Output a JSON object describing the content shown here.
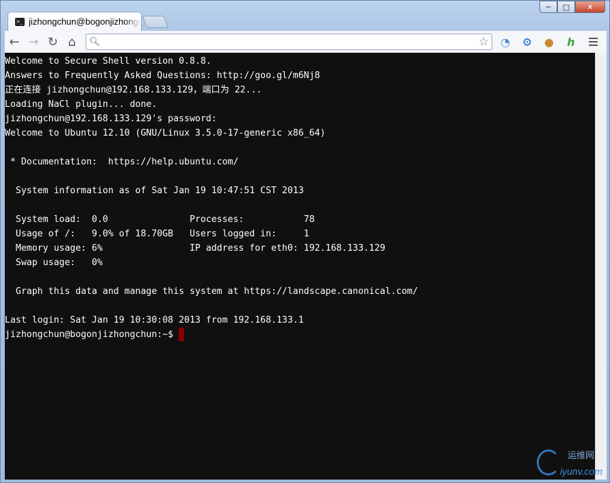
{
  "window": {
    "tab_title": "jizhongchun@bogonjizhongchun:~",
    "favicon_glyph": ">_",
    "controls": {
      "minimize": "─",
      "maximize": "□",
      "close": "✕"
    }
  },
  "toolbar": {
    "back": "←",
    "forward": "→",
    "reload": "↻",
    "home": "⌂",
    "omnibox_value": "",
    "omnibox_icon": "search-icon",
    "extensions": [
      "secure-shell-icon",
      "settings-gear-icon",
      "cookie-icon",
      "h-extension-icon"
    ]
  },
  "terminal": {
    "lines": [
      "Welcome to Secure Shell version 0.8.8.",
      "Answers to Frequently Asked Questions: http://goo.gl/m6Nj8",
      "正在连接 jizhongchun@192.168.133.129，端口为 22...",
      "Loading NaCl plugin... done.",
      "jizhongchun@192.168.133.129's password:",
      "Welcome to Ubuntu 12.10 (GNU/Linux 3.5.0-17-generic x86_64)",
      "",
      " * Documentation:  https://help.ubuntu.com/",
      "",
      "  System information as of Sat Jan 19 10:47:51 CST 2013",
      "",
      "  System load:  0.0               Processes:           78",
      "  Usage of /:   9.0% of 18.70GB   Users logged in:     1",
      "  Memory usage: 6%                IP address for eth0: 192.168.133.129",
      "  Swap usage:   0%",
      "",
      "  Graph this data and manage this system at https://landscape.canonical.com/",
      "",
      "Last login: Sat Jan 19 10:30:08 2013 from 192.168.133.1"
    ],
    "prompt": "jizhongchun@bogonjizhongchun:~$ "
  },
  "watermark": {
    "cn": "运维网",
    "en": "iyunv.com"
  },
  "colors": {
    "terminal_bg": "#101010",
    "terminal_fg": "#ffffff",
    "cursor": "#8b0000"
  }
}
